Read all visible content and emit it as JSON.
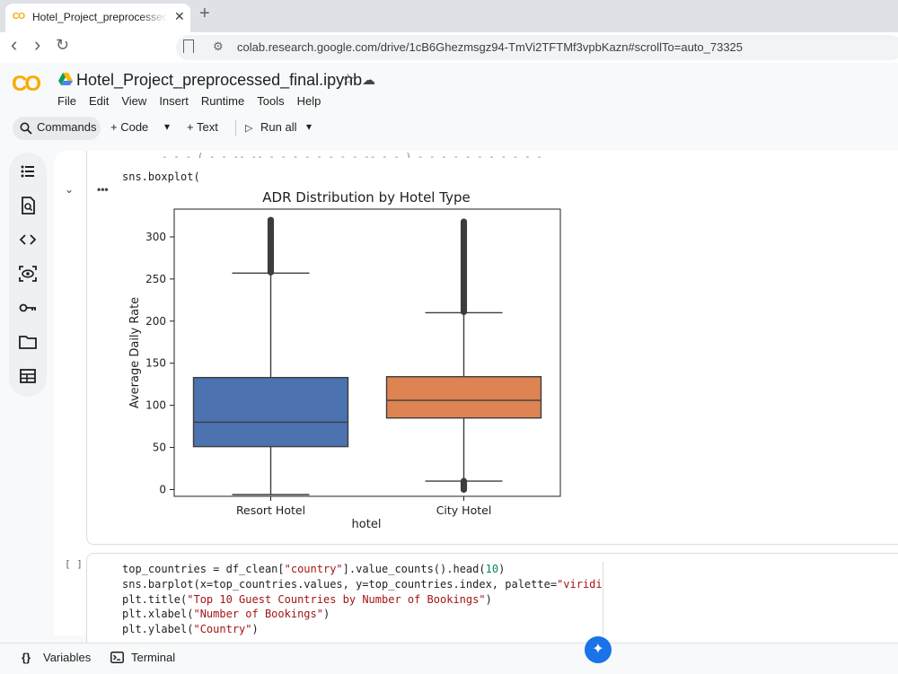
{
  "browser": {
    "tab_title": "Hotel_Project_preprocessed_final.ipynb",
    "tab_favicon": "CO",
    "close_glyph": "✕",
    "new_tab_glyph": "+",
    "back_glyph": "‹",
    "forward_glyph": "›",
    "reload_glyph": "↻",
    "site_info_glyph": "⚙",
    "url": "colab.research.google.com/drive/1cB6Ghezmsgz94-TmVi2TFTMf3vpbKazn#scrollTo=auto_73325"
  },
  "colab": {
    "logo": "CO",
    "notebook_title": "Hotel_Project_preprocessed_final.ipynb",
    "star_glyph": "☆",
    "cloud_glyph": "☁",
    "menu": [
      "File",
      "Edit",
      "View",
      "Insert",
      "Runtime",
      "Tools",
      "Help"
    ],
    "toolbar": {
      "commands": "Commands",
      "code": "+ Code",
      "text": "+ Text",
      "run_all": "Run all",
      "caret": "▾",
      "search_glyph": "⚲",
      "play_glyph": "▷"
    },
    "sidebar_icons": [
      "toc-icon",
      "find-icon",
      "code-snippets-icon",
      "inspector-icon",
      "secrets-key-icon",
      "files-folder-icon",
      "data-table-icon"
    ]
  },
  "cell1": {
    "code_line": "sns.boxplot(",
    "cut_line": "-  -  - ( - - -- --  - - -  - - -   - - -- - - )  -     -   -   -  -  - - - -   -  -",
    "collapse_glyph": "⌄",
    "dots_glyph": "•••"
  },
  "chart_data": {
    "type": "box",
    "title": "ADR Distribution by Hotel Type",
    "xlabel": "hotel",
    "ylabel": "Average Daily Rate",
    "categories": [
      "Resort Hotel",
      "City Hotel"
    ],
    "ylim": [
      -8,
      333
    ],
    "yticks": [
      0,
      50,
      100,
      150,
      200,
      250,
      300
    ],
    "grid": false,
    "colors": [
      "#4c72b0",
      "#dd8452"
    ],
    "boxes": [
      {
        "name": "Resort Hotel",
        "whisker_low": -6,
        "q1": 51,
        "median": 80,
        "q3": 133,
        "whisker_high": 257,
        "outliers_high": [
          258,
          320
        ],
        "outliers_low": []
      },
      {
        "name": "City Hotel",
        "whisker_low": 10,
        "q1": 85,
        "median": 106,
        "q3": 134,
        "whisker_high": 210,
        "outliers_high": [
          211,
          318
        ],
        "outliers_low": [
          0,
          10
        ]
      }
    ]
  },
  "cell2": {
    "bracket": "[ ]",
    "lines": [
      [
        {
          "t": "top_countries = df_clean[",
          "c": "p"
        },
        {
          "t": "\"country\"",
          "c": "s"
        },
        {
          "t": "].value_counts().head(",
          "c": "p"
        },
        {
          "t": "10",
          "c": "n"
        },
        {
          "t": ")",
          "c": "p"
        }
      ],
      [
        {
          "t": "sns.barplot(x=top_countries.values, y=top_countries.index, palette=",
          "c": "p"
        },
        {
          "t": "\"viridis\"",
          "c": "s"
        },
        {
          "t": ")",
          "c": "p"
        }
      ],
      [
        {
          "t": "plt.title(",
          "c": "p"
        },
        {
          "t": "\"Top 10 Guest Countries by Number of Bookings\"",
          "c": "s"
        },
        {
          "t": ")",
          "c": "p"
        }
      ],
      [
        {
          "t": "plt.xlabel(",
          "c": "p"
        },
        {
          "t": "\"Number of Bookings\"",
          "c": "s"
        },
        {
          "t": ")",
          "c": "p"
        }
      ],
      [
        {
          "t": "plt.ylabel(",
          "c": "p"
        },
        {
          "t": "\"Country\"",
          "c": "s"
        },
        {
          "t": ")",
          "c": "p"
        }
      ]
    ]
  },
  "bottom": {
    "variables": "Variables",
    "variables_glyph": "{}",
    "terminal": "Terminal",
    "terminal_glyph": "▭",
    "gemini_glyph": "✦"
  }
}
